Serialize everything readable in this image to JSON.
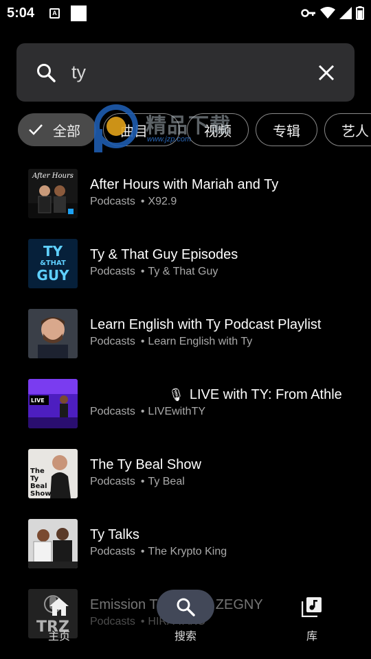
{
  "status_bar": {
    "time": "5:04",
    "a_badge": "A",
    "icons": [
      "key-icon",
      "wifi-icon",
      "signal-icon",
      "battery-icon"
    ]
  },
  "search": {
    "query": "ty",
    "icon": "search-icon",
    "clear_icon": "close-icon"
  },
  "filters": {
    "chips": [
      {
        "label": "全部",
        "selected": true
      },
      {
        "label": "曲目",
        "selected": false
      },
      {
        "label": "视频",
        "selected": false
      },
      {
        "label": "专辑",
        "selected": false
      },
      {
        "label": "艺人",
        "selected": false
      }
    ]
  },
  "watermark": {
    "text": "精品下载",
    "url": "www.jzp.com"
  },
  "results": [
    {
      "title": "After Hours with Mariah and Ty",
      "type": "Podcasts",
      "author": "X92.9"
    },
    {
      "title": "Ty & That Guy Episodes",
      "type": "Podcasts",
      "author": "Ty & That Guy"
    },
    {
      "title": "Learn English with Ty Podcast Playlist",
      "type": "Podcasts",
      "author": "Learn English with Ty"
    },
    {
      "title": "LIVE with TY: From Athlet",
      "type": "Podcasts",
      "author": "LIVEwithTY"
    },
    {
      "title": "The Ty Beal Show",
      "type": "Podcasts",
      "author": "Ty Beal"
    },
    {
      "title": "Ty Talks",
      "type": "Podcasts",
      "author": "The Krypto King"
    },
    {
      "title": "Emission T",
      "title_tail": "HA ZEGNY",
      "type": "Podcasts",
      "author": "HIRA TAKO"
    }
  ],
  "thumbnails": {
    "after_hours": "After Hours",
    "ty_that_guy": [
      "TY",
      "&THAT",
      "GUY"
    ],
    "live": "LIVE",
    "beal": [
      "The",
      "Ty",
      "Beal",
      "Show"
    ],
    "trz": "TRZ"
  },
  "bottom_nav": {
    "home_label": "主页",
    "search_label": "搜索",
    "library_label": "库"
  }
}
